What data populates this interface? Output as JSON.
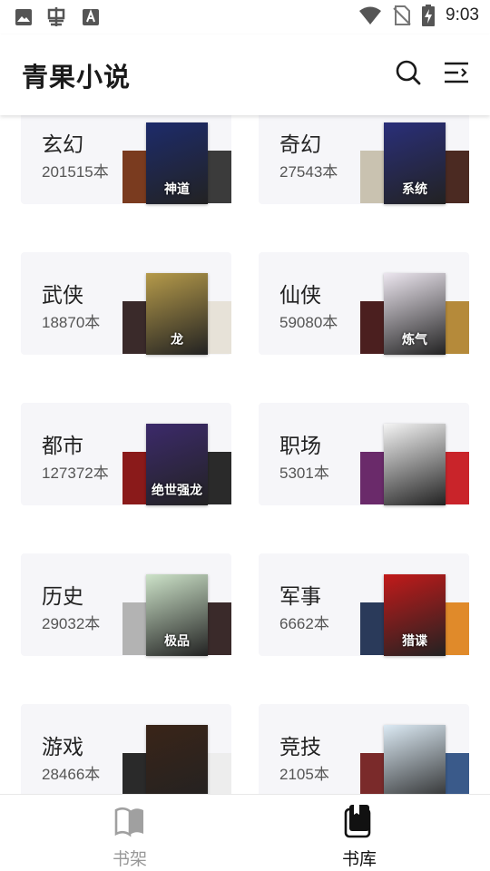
{
  "status_bar": {
    "time": "9:03",
    "left_icons": [
      "image-icon",
      "bug-icon",
      "font-a-icon"
    ],
    "right_icons": [
      "wifi-icon",
      "no-sim-icon",
      "battery-charging-icon"
    ]
  },
  "header": {
    "title": "青果小说",
    "actions": [
      "search-icon",
      "menu-icon"
    ]
  },
  "categories": [
    {
      "name": "玄幻",
      "count": "201515本",
      "cover_text": "神道",
      "colors": [
        "#1d2b6b",
        "#7a3b1f",
        "#3b3b3b"
      ]
    },
    {
      "name": "奇幻",
      "count": "27543本",
      "cover_text": "系统",
      "colors": [
        "#2a2f7a",
        "#c9c2b0",
        "#4b2a22"
      ]
    },
    {
      "name": "武侠",
      "count": "18870本",
      "cover_text": "龙",
      "colors": [
        "#b59a4a",
        "#3a2a2a",
        "#e7e2d8"
      ]
    },
    {
      "name": "仙侠",
      "count": "59080本",
      "cover_text": "炼气",
      "colors": [
        "#ece6ef",
        "#4b1f1f",
        "#b58a3a"
      ]
    },
    {
      "name": "都市",
      "count": "127372本",
      "cover_text": "绝世强龙",
      "colors": [
        "#3c2a6b",
        "#8a1a1a",
        "#2a2a2a"
      ]
    },
    {
      "name": "职场",
      "count": "5301本",
      "cover_text": "",
      "colors": [
        "#f4f4f4",
        "#6a2a6a",
        "#c9242a"
      ]
    },
    {
      "name": "历史",
      "count": "29032本",
      "cover_text": "极品",
      "colors": [
        "#cde3c9",
        "#b3b3b3",
        "#3a2a2a"
      ]
    },
    {
      "name": "军事",
      "count": "6662本",
      "cover_text": "猎谍",
      "colors": [
        "#c21a1a",
        "#2a3a5a",
        "#e08a2a"
      ]
    },
    {
      "name": "游戏",
      "count": "28466本",
      "cover_text": "",
      "colors": [
        "#3a2418",
        "#2a2a2a",
        "#ededed"
      ]
    },
    {
      "name": "竞技",
      "count": "2105本",
      "cover_text": "",
      "colors": [
        "#dceaf4",
        "#7a2a2a",
        "#3a5a8a"
      ]
    }
  ],
  "bottom_nav": [
    {
      "label": "书架",
      "icon": "open-book-icon",
      "active": false,
      "color": "#999999"
    },
    {
      "label": "书库",
      "icon": "book-stack-icon",
      "active": true,
      "color": "#111111"
    }
  ]
}
